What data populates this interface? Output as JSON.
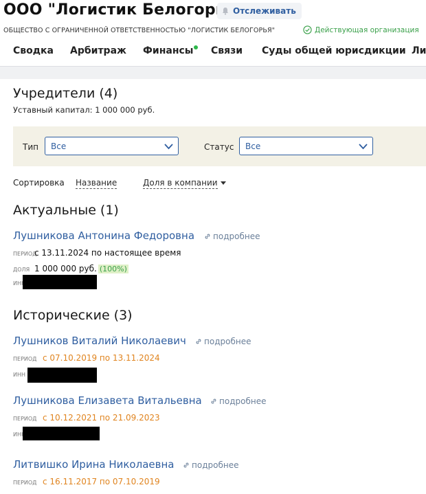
{
  "company": {
    "title": "ООО \"Логистик Белогорья\"",
    "follow_label": "Отслеживать",
    "full_name": "ОБЩЕСТВО С ОГРАНИЧЕННОЙ ОТВЕТСТВЕННОСТЬЮ \"ЛОГИСТИК БЕЛОГОРЬЯ\"",
    "status": "Действующая организация"
  },
  "tabs": [
    {
      "label": "Сводка"
    },
    {
      "label": "Арбитраж"
    },
    {
      "label": "Финансы",
      "has_dot": true
    },
    {
      "label": "Связи"
    },
    {
      "label": "Суды общей юрисдикции"
    },
    {
      "label": "Ли"
    }
  ],
  "founders": {
    "heading": "Учредители (4)",
    "capital": "Уставный капитал: 1 000 000 руб.",
    "filters": {
      "type_label": "Тип",
      "type_value": "Все",
      "status_label": "Статус",
      "status_value": "Все"
    },
    "sort": {
      "label": "Сортировка",
      "by_name": "Название",
      "by_share": "Доля в компании"
    },
    "current": {
      "heading": "Актуальные (1)",
      "items": [
        {
          "name": "Лушникова Антонина Федоровна",
          "more": "подробнее",
          "period_label": "период",
          "period": "с 13.11.2024 по настоящее время",
          "share_label": "доля",
          "share": "1 000 000 руб.",
          "share_pct": "(100%)",
          "inn_label": "инн"
        }
      ]
    },
    "historical": {
      "heading": "Исторические (3)",
      "items": [
        {
          "name": "Лушников Виталий Николаевич",
          "more": "подробнее",
          "period_label": "период",
          "period": "с 07.10.2019 по 13.11.2024",
          "inn_label": "инн"
        },
        {
          "name": "Лушникова Елизавета Витальевна",
          "more": "подробнее",
          "period_label": "период",
          "period": "с 10.12.2021 по 21.09.2023",
          "inn_label": "инн"
        },
        {
          "name": "Литвишко Ирина Николаевна",
          "more": "подробнее",
          "period_label": "период",
          "period": "с 16.11.2017 по 07.10.2019"
        }
      ]
    }
  },
  "colors": {
    "link": "#2f5ea0",
    "active_status": "#3aa04a",
    "historical_period": "#e0841f",
    "filter_bg": "#f3f1e6"
  }
}
